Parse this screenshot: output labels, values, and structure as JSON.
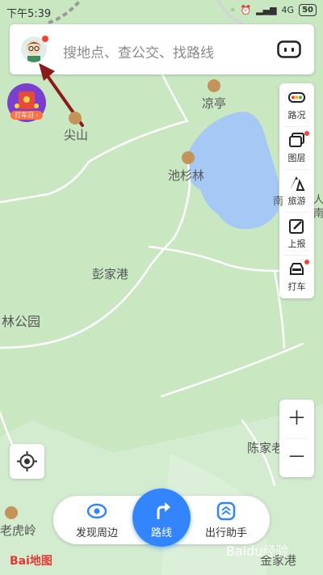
{
  "statusbar": {
    "time": "下午5:39",
    "network": "4G",
    "battery": "50"
  },
  "search": {
    "placeholder": "搜地点、查公交、找路线"
  },
  "promo": {
    "label": "打车日 ›"
  },
  "toolbar": {
    "items": [
      {
        "label": "路况",
        "icon": "traffic-light-icon"
      },
      {
        "label": "图层",
        "icon": "layers-icon"
      },
      {
        "label": "旅游",
        "icon": "travel-icon"
      },
      {
        "label": "上报",
        "icon": "report-icon"
      },
      {
        "label": "打车",
        "icon": "taxi-icon"
      }
    ]
  },
  "map": {
    "labels": {
      "liangting": "凉亭",
      "jianshan": "尖山",
      "chishanlin": "池杉林",
      "pengjiagang": "彭家港",
      "lingongyuan": "林公园",
      "chenjia": "陈家老",
      "laohuling": "老虎岭",
      "jinjiagang": "金家港",
      "edge1": "南",
      "edge2": "人",
      "edge3": "南"
    }
  },
  "bottom": {
    "discover": "发现周边",
    "route": "路线",
    "assistant": "出行助手"
  },
  "logo": "Bai地图",
  "watermark": "Baidu经验",
  "colors": {
    "accent": "#3385ff",
    "map_green": "#c9e8c2",
    "water": "#a6c8f5",
    "arrow": "#8b1a1a"
  }
}
